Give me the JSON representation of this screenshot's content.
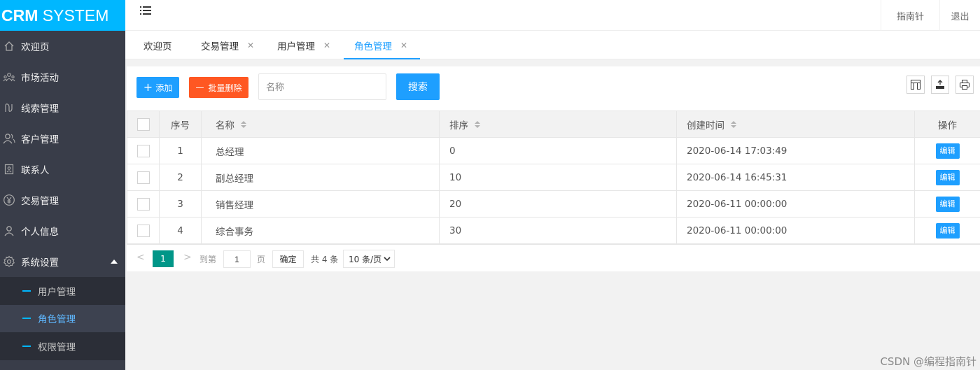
{
  "logo": {
    "bold": "CRM",
    "rest": " SYSTEM"
  },
  "sidebar": {
    "items": [
      {
        "label": "欢迎页",
        "icon": "home-icon"
      },
      {
        "label": "市场活动",
        "icon": "people-icon"
      },
      {
        "label": "线索管理",
        "icon": "clue-icon"
      },
      {
        "label": "客户管理",
        "icon": "customer-icon"
      },
      {
        "label": "联系人",
        "icon": "contact-card-icon"
      },
      {
        "label": "交易管理",
        "icon": "yen-icon"
      },
      {
        "label": "个人信息",
        "icon": "user-icon"
      },
      {
        "label": "系统设置",
        "icon": "gear-icon"
      }
    ],
    "sub_items": [
      {
        "label": "用户管理"
      },
      {
        "label": "角色管理"
      },
      {
        "label": "权限管理"
      }
    ]
  },
  "header": {
    "guide": "指南针",
    "logout": "退出"
  },
  "tabs": [
    {
      "label": "欢迎页"
    },
    {
      "label": "交易管理"
    },
    {
      "label": "用户管理"
    },
    {
      "label": "角色管理"
    }
  ],
  "toolbar": {
    "add_label": "添加",
    "batch_delete_label": "批量删除",
    "search_placeholder": "名称",
    "search_label": "搜索"
  },
  "table": {
    "headers": {
      "no": "序号",
      "name": "名称",
      "sort": "排序",
      "created": "创建时间",
      "action": "操作"
    },
    "rows": [
      {
        "no": "1",
        "name": "总经理",
        "sort": "0",
        "created": "2020-06-14 17:03:49",
        "action": "编辑"
      },
      {
        "no": "2",
        "name": "副总经理",
        "sort": "10",
        "created": "2020-06-14 16:45:31",
        "action": "编辑"
      },
      {
        "no": "3",
        "name": "销售经理",
        "sort": "20",
        "created": "2020-06-11 00:00:00",
        "action": "编辑"
      },
      {
        "no": "4",
        "name": "综合事务",
        "sort": "30",
        "created": "2020-06-11 00:00:00",
        "action": "编辑"
      }
    ]
  },
  "pager": {
    "current": "1",
    "goto_label": "到第",
    "goto_value": "1",
    "page_label": "页",
    "confirm_label": "确定",
    "total_label": "共 4 条",
    "page_size_label": "10 条/页"
  },
  "watermark": "CSDN @编程指南针",
  "colors": {
    "brand": "#00b7ff",
    "primary": "#1e9fff",
    "danger": "#ff5722",
    "pager_current": "#009688",
    "sidebar": "#393d49"
  }
}
